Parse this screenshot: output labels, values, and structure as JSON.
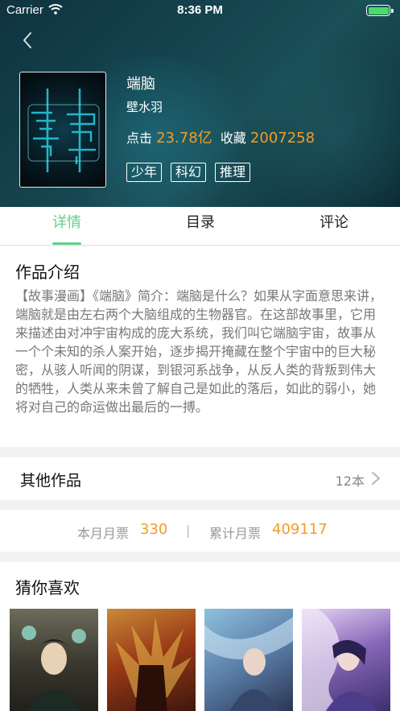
{
  "status": {
    "carrier": "Carrier",
    "time": "8:36 PM"
  },
  "book": {
    "title": "端脑",
    "author": "壁水羽",
    "clicks_label": "点击",
    "clicks_value": "23.78亿",
    "favorites_label": "收藏",
    "favorites_value": "2007258",
    "tags": [
      "少年",
      "科幻",
      "推理"
    ]
  },
  "tabs": [
    {
      "label": "详情",
      "active": true
    },
    {
      "label": "目录",
      "active": false
    },
    {
      "label": "评论",
      "active": false
    }
  ],
  "intro": {
    "heading": "作品介绍",
    "text": "【故事漫画】《端脑》简介：端脑是什么？如果从字面意思来讲，端脑就是由左右两个大脑组成的生物器官。在这部故事里，它用来描述由对冲宇宙构成的庞大系统，我们叫它端脑宇宙，故事从一个个未知的杀人案开始，逐步揭开掩藏在整个宇宙中的巨大秘密，从骇人听闻的阴谋，到银河系战争，从反人类的背叛到伟大的牺牲，人类从来未曾了解自己是如此的落后，如此的弱小，她将对自己的命运做出最后的一搏。"
  },
  "other_works": {
    "label": "其他作品",
    "count": "12本"
  },
  "tickets": {
    "month_label": "本月月票",
    "month_value": "330",
    "separator": "|",
    "total_label": "累计月票",
    "total_value": "409117"
  },
  "guess": {
    "heading": "猜你喜欢"
  },
  "colors": {
    "accent_green": "#5fd08c",
    "number_orange": "#f39c27"
  }
}
